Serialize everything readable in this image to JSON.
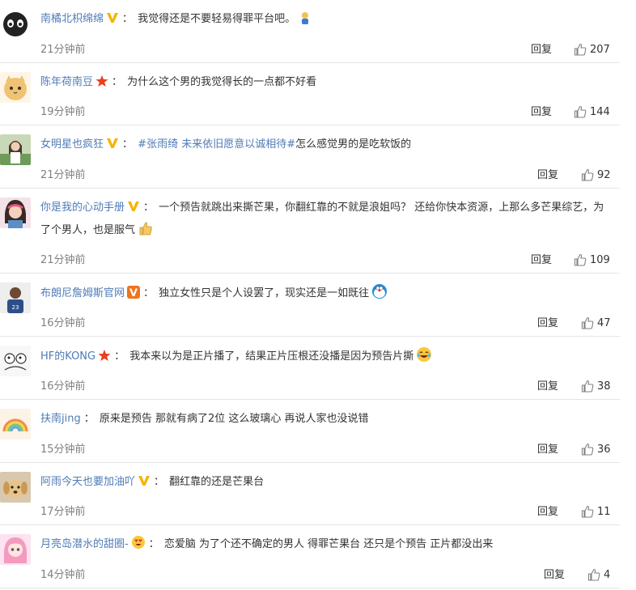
{
  "comments": [
    {
      "user": "南橘北枳绵绵",
      "badge": "vip-v-icon",
      "text": "我觉得还是不要轻易得罪平台吧。",
      "topic": "",
      "emoji": "figure-emoji",
      "time": "21分钟前",
      "reply": "回复",
      "likes": "207"
    },
    {
      "user": "陈年荷南豆",
      "badge": "red-star-icon",
      "text": "为什么这个男的我觉得长的一点都不好看",
      "topic": "",
      "emoji": "",
      "time": "19分钟前",
      "reply": "回复",
      "likes": "144"
    },
    {
      "user": "女明星也疯狂",
      "badge": "vip-v-icon",
      "text": "怎么感觉男的是吃软饭的",
      "topic": "#张雨绮 未来依旧愿意以诚相待#",
      "emoji": "",
      "time": "21分钟前",
      "reply": "回复",
      "likes": "92"
    },
    {
      "user": "你是我的心动手册",
      "badge": "vip-v-icon",
      "text": "一个预告就跳出来撕芒果，你翻红靠的不就是浪姐吗？ 还给你快本资源，上那么多芒果综艺，为了个男人，也是服气",
      "topic": "",
      "emoji": "thumbs-up-emoji",
      "time": "21分钟前",
      "reply": "回复",
      "likes": "109"
    },
    {
      "user": "布朗尼詹姆斯官网",
      "badge": "orange-v-icon",
      "text": "独立女性只是个人设罢了，现实还是一如既往",
      "topic": "",
      "emoji": "doraemon-emoji",
      "time": "16分钟前",
      "reply": "回复",
      "likes": "47"
    },
    {
      "user": "HF的KONG",
      "badge": "red-star-icon",
      "text": "我本来以为是正片播了，结果正片压根还没播是因为预告片撕",
      "topic": "",
      "emoji": "laugh-cry-emoji",
      "time": "16分钟前",
      "reply": "回复",
      "likes": "38"
    },
    {
      "user": "扶南jing",
      "badge": "",
      "text": "原来是预告 那就有病了2位 这么玻璃心 再说人家也没说错",
      "topic": "",
      "emoji": "",
      "time": "15分钟前",
      "reply": "回复",
      "likes": "36"
    },
    {
      "user": "阿雨今天也要加油吖",
      "badge": "vip-v-icon",
      "text": "翻红靠的还是芒果台",
      "topic": "",
      "emoji": "",
      "time": "17分钟前",
      "reply": "回复",
      "likes": "11"
    },
    {
      "user": "月亮岛潜水的甜圈-",
      "badge": "heart-eyes-icon",
      "text": "恋爱脑 为了个还不确定的男人 得罪芒果台 还只是个预告 正片都没出来",
      "topic": "",
      "emoji": "",
      "time": "14分钟前",
      "reply": "回复",
      "likes": "4"
    }
  ],
  "colors": {
    "link": "#4f7bb5",
    "meta": "#808080",
    "divider": "#e4e4e4",
    "vip": "#f5b400"
  }
}
